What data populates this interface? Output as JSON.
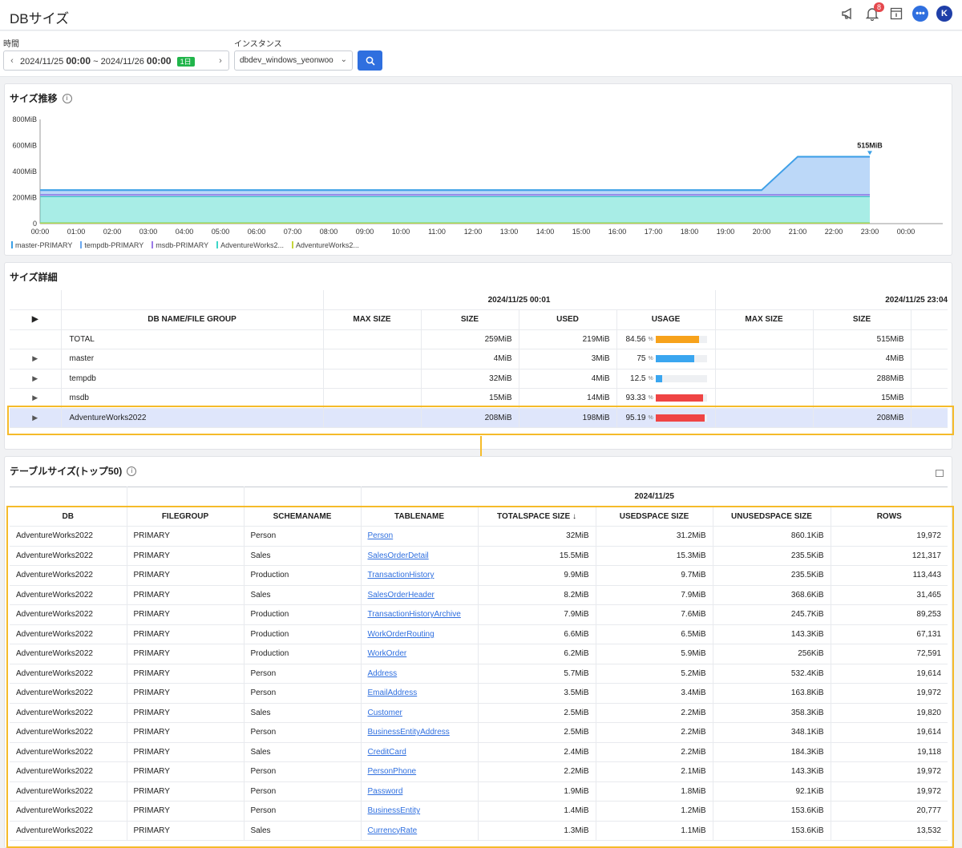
{
  "header": {
    "title": "DBサイズ",
    "notification_count": "8",
    "chat_label": "•••",
    "avatar_initial": "K"
  },
  "filters": {
    "time_label": "時間",
    "time_start_date": "2024/11/25",
    "time_start_time": "00:00",
    "time_sep": "~",
    "time_end_date": "2024/11/26",
    "time_end_time": "00:00",
    "range_tag": "1日",
    "instance_label": "インスタンス",
    "instance_value": "dbdev_windows_yeonwoo"
  },
  "size_trend": {
    "title": "サイズ推移",
    "y_ticks": [
      "800MiB",
      "600MiB",
      "400MiB",
      "200MiB",
      "0"
    ],
    "x_ticks": [
      "00:00",
      "01:00",
      "02:00",
      "03:00",
      "04:00",
      "05:00",
      "06:00",
      "07:00",
      "08:00",
      "09:00",
      "10:00",
      "11:00",
      "12:00",
      "13:00",
      "14:00",
      "15:00",
      "16:00",
      "17:00",
      "18:00",
      "19:00",
      "20:00",
      "21:00",
      "22:00",
      "23:00",
      "00:00"
    ],
    "annotation": "515MiB",
    "legend": [
      {
        "name": "master-PRIMARY",
        "color": "#3aa0e6"
      },
      {
        "name": "tempdb-PRIMARY",
        "color": "#6aa8f0"
      },
      {
        "name": "msdb-PRIMARY",
        "color": "#9b7be8"
      },
      {
        "name": "AdventureWorks2...",
        "color": "#3dd6c8"
      },
      {
        "name": "AdventureWorks2...",
        "color": "#c6d63a"
      }
    ]
  },
  "chart_data": {
    "type": "area",
    "title": "サイズ推移",
    "x": [
      "00:00",
      "01:00",
      "02:00",
      "03:00",
      "04:00",
      "05:00",
      "06:00",
      "07:00",
      "08:00",
      "09:00",
      "10:00",
      "11:00",
      "12:00",
      "13:00",
      "14:00",
      "15:00",
      "16:00",
      "17:00",
      "18:00",
      "19:00",
      "20:00",
      "21:00",
      "22:00",
      "23:00"
    ],
    "ylim": [
      0,
      800
    ],
    "yunit": "MiB",
    "stacked": true,
    "series": [
      {
        "name": "AdventureWorks2...",
        "color": "#c6d63a",
        "values": [
          5,
          5,
          5,
          5,
          5,
          5,
          5,
          5,
          5,
          5,
          5,
          5,
          5,
          5,
          5,
          5,
          5,
          5,
          5,
          5,
          5,
          5,
          5,
          5
        ]
      },
      {
        "name": "AdventureWorks2...",
        "color": "#3dd6c8",
        "values": [
          203,
          203,
          203,
          203,
          203,
          203,
          203,
          203,
          203,
          203,
          203,
          203,
          203,
          203,
          203,
          203,
          203,
          203,
          203,
          203,
          203,
          203,
          203,
          203
        ]
      },
      {
        "name": "msdb-PRIMARY",
        "color": "#9b7be8",
        "values": [
          15,
          15,
          15,
          15,
          15,
          15,
          15,
          15,
          15,
          15,
          15,
          15,
          15,
          15,
          15,
          15,
          15,
          15,
          15,
          15,
          15,
          15,
          15,
          15
        ]
      },
      {
        "name": "tempdb-PRIMARY",
        "color": "#6aa8f0",
        "values": [
          32,
          32,
          32,
          32,
          32,
          32,
          32,
          32,
          32,
          32,
          32,
          32,
          32,
          32,
          32,
          32,
          32,
          32,
          32,
          32,
          32,
          288,
          288,
          288
        ]
      },
      {
        "name": "master-PRIMARY",
        "color": "#3aa0e6",
        "values": [
          4,
          4,
          4,
          4,
          4,
          4,
          4,
          4,
          4,
          4,
          4,
          4,
          4,
          4,
          4,
          4,
          4,
          4,
          4,
          4,
          4,
          4,
          4,
          4
        ]
      }
    ],
    "grid": false,
    "legend": "bottom-left"
  },
  "size_detail": {
    "title": "サイズ詳細",
    "group1": "2024/11/25 00:01",
    "group2": "2024/11/25 23:04",
    "columns": [
      "DB NAME/FILE GROUP",
      "MAX SIZE",
      "SIZE",
      "USED",
      "USAGE",
      "MAX SIZE",
      "SIZE"
    ],
    "rows": [
      {
        "name": "TOTAL",
        "max": "",
        "size": "259MiB",
        "used": "219MiB",
        "usage": "84.56",
        "usage_value": 0.8456,
        "color": "#f7a21b",
        "max2": "",
        "size2": "515MiB"
      },
      {
        "name": "master",
        "max": "",
        "size": "4MiB",
        "used": "3MiB",
        "usage": "75",
        "usage_value": 0.75,
        "color": "#3aa6f0",
        "max2": "",
        "size2": "4MiB"
      },
      {
        "name": "tempdb",
        "max": "",
        "size": "32MiB",
        "used": "4MiB",
        "usage": "12.5",
        "usage_value": 0.125,
        "color": "#3aa6f0",
        "max2": "",
        "size2": "288MiB"
      },
      {
        "name": "msdb",
        "max": "",
        "size": "15MiB",
        "used": "14MiB",
        "usage": "93.33",
        "usage_value": 0.9333,
        "color": "#ef4444",
        "max2": "",
        "size2": "15MiB"
      },
      {
        "name": "AdventureWorks2022",
        "max": "",
        "size": "208MiB",
        "used": "198MiB",
        "usage": "95.19",
        "usage_value": 0.9519,
        "color": "#ef4444",
        "max2": "",
        "size2": "208MiB"
      }
    ],
    "percent_sign": "%"
  },
  "table_size": {
    "title": "テーブルサイズ(トップ50)",
    "group_date": "2024/11/25",
    "columns": [
      "DB",
      "FILEGROUP",
      "SCHEMANAME",
      "TABLENAME",
      "TOTALSPACE SIZE ↓",
      "USEDSPACE SIZE",
      "UNUSEDSPACE SIZE",
      "ROWS"
    ],
    "rows": [
      [
        "AdventureWorks2022",
        "PRIMARY",
        "Person",
        "Person",
        "32MiB",
        "31.2MiB",
        "860.1KiB",
        "19,972"
      ],
      [
        "AdventureWorks2022",
        "PRIMARY",
        "Sales",
        "SalesOrderDetail",
        "15.5MiB",
        "15.3MiB",
        "235.5KiB",
        "121,317"
      ],
      [
        "AdventureWorks2022",
        "PRIMARY",
        "Production",
        "TransactionHistory",
        "9.9MiB",
        "9.7MiB",
        "235.5KiB",
        "113,443"
      ],
      [
        "AdventureWorks2022",
        "PRIMARY",
        "Sales",
        "SalesOrderHeader",
        "8.2MiB",
        "7.9MiB",
        "368.6KiB",
        "31,465"
      ],
      [
        "AdventureWorks2022",
        "PRIMARY",
        "Production",
        "TransactionHistoryArchive",
        "7.9MiB",
        "7.6MiB",
        "245.7KiB",
        "89,253"
      ],
      [
        "AdventureWorks2022",
        "PRIMARY",
        "Production",
        "WorkOrderRouting",
        "6.6MiB",
        "6.5MiB",
        "143.3KiB",
        "67,131"
      ],
      [
        "AdventureWorks2022",
        "PRIMARY",
        "Production",
        "WorkOrder",
        "6.2MiB",
        "5.9MiB",
        "256KiB",
        "72,591"
      ],
      [
        "AdventureWorks2022",
        "PRIMARY",
        "Person",
        "Address",
        "5.7MiB",
        "5.2MiB",
        "532.4KiB",
        "19,614"
      ],
      [
        "AdventureWorks2022",
        "PRIMARY",
        "Person",
        "EmailAddress",
        "3.5MiB",
        "3.4MiB",
        "163.8KiB",
        "19,972"
      ],
      [
        "AdventureWorks2022",
        "PRIMARY",
        "Sales",
        "Customer",
        "2.5MiB",
        "2.2MiB",
        "358.3KiB",
        "19,820"
      ],
      [
        "AdventureWorks2022",
        "PRIMARY",
        "Person",
        "BusinessEntityAddress",
        "2.5MiB",
        "2.2MiB",
        "348.1KiB",
        "19,614"
      ],
      [
        "AdventureWorks2022",
        "PRIMARY",
        "Sales",
        "CreditCard",
        "2.4MiB",
        "2.2MiB",
        "184.3KiB",
        "19,118"
      ],
      [
        "AdventureWorks2022",
        "PRIMARY",
        "Person",
        "PersonPhone",
        "2.2MiB",
        "2.1MiB",
        "143.3KiB",
        "19,972"
      ],
      [
        "AdventureWorks2022",
        "PRIMARY",
        "Person",
        "Password",
        "1.9MiB",
        "1.8MiB",
        "92.1KiB",
        "19,972"
      ],
      [
        "AdventureWorks2022",
        "PRIMARY",
        "Person",
        "BusinessEntity",
        "1.4MiB",
        "1.2MiB",
        "153.6KiB",
        "20,777"
      ],
      [
        "AdventureWorks2022",
        "PRIMARY",
        "Sales",
        "CurrencyRate",
        "1.3MiB",
        "1.1MiB",
        "153.6KiB",
        "13,532"
      ]
    ]
  }
}
